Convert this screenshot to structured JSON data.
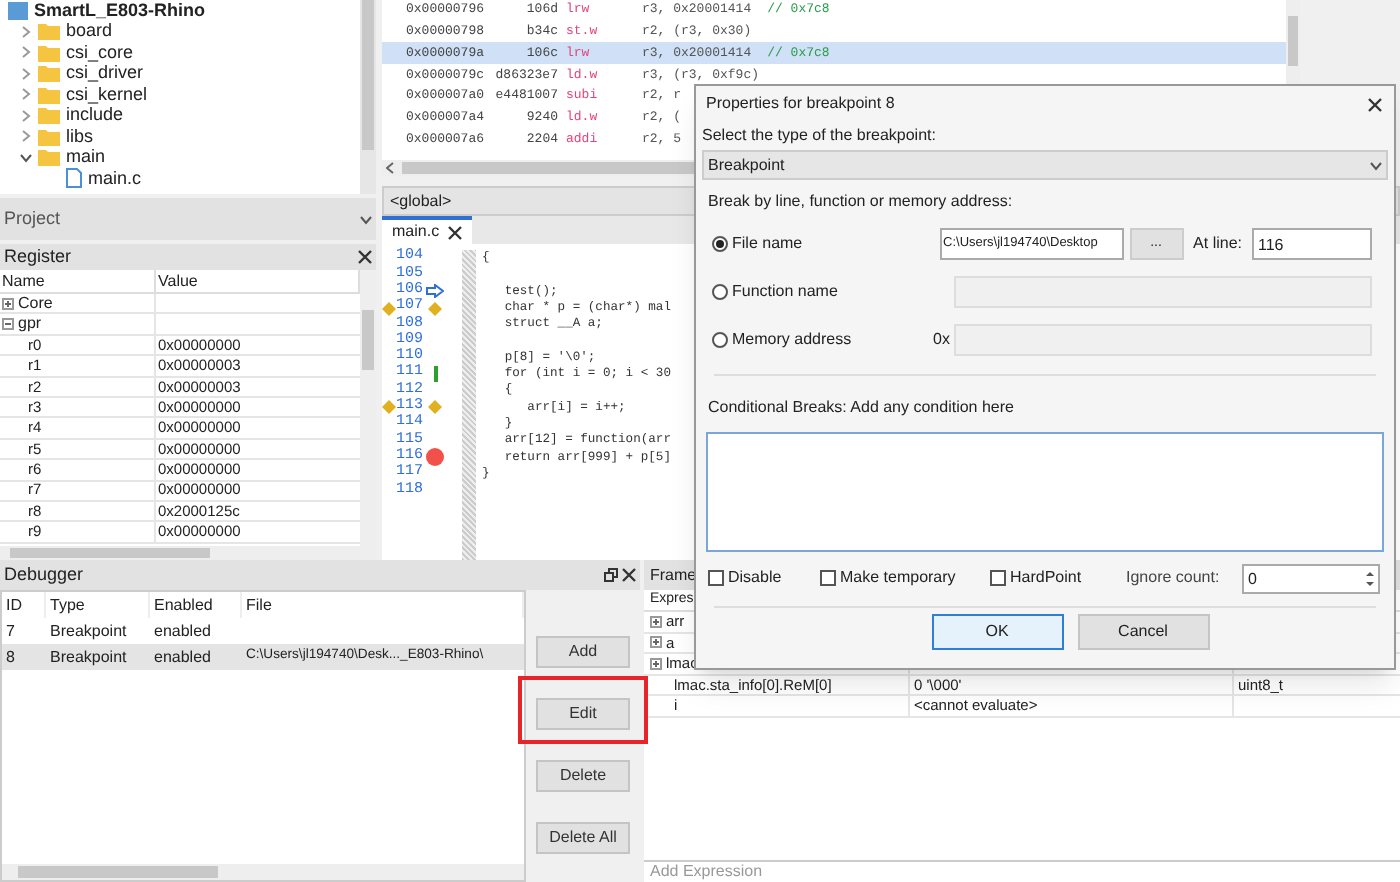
{
  "project_tree": {
    "root": "SmartL_E803-Rhino",
    "children": [
      {
        "name": "board",
        "kind": "folder",
        "expanded": false
      },
      {
        "name": "csi_core",
        "kind": "folder",
        "expanded": false
      },
      {
        "name": "csi_driver",
        "kind": "folder",
        "expanded": false
      },
      {
        "name": "csi_kernel",
        "kind": "folder",
        "expanded": false
      },
      {
        "name": "include",
        "kind": "folder",
        "expanded": false
      },
      {
        "name": "libs",
        "kind": "folder",
        "expanded": false
      },
      {
        "name": "main",
        "kind": "folder",
        "expanded": true,
        "children": [
          {
            "name": "main.c",
            "kind": "file"
          }
        ]
      }
    ]
  },
  "project_bar": {
    "title": "Project"
  },
  "register": {
    "title": "Register",
    "columns": [
      "Name",
      "Value"
    ],
    "groups": [
      {
        "name": "Core",
        "expanded": false
      },
      {
        "name": "gpr",
        "expanded": true,
        "children": [
          {
            "name": "r0",
            "value": "0x00000000"
          },
          {
            "name": "r1",
            "value": "0x00000003"
          },
          {
            "name": "r2",
            "value": "0x00000003"
          },
          {
            "name": "r3",
            "value": "0x00000000"
          },
          {
            "name": "r4",
            "value": "0x00000000"
          },
          {
            "name": "r5",
            "value": "0x00000000"
          },
          {
            "name": "r6",
            "value": "0x00000000"
          },
          {
            "name": "r7",
            "value": "0x00000000"
          },
          {
            "name": "r8",
            "value": "0x2000125c"
          },
          {
            "name": "r9",
            "value": "0x00000000"
          }
        ]
      }
    ]
  },
  "disassembly": [
    {
      "address": "0x00000796",
      "opcode": "106d",
      "mnemonic": "lrw",
      "operands": "r3, 0x20001414",
      "comment": "// 0x7c8",
      "selected": false
    },
    {
      "address": "0x00000798",
      "opcode": "b34c",
      "mnemonic": "st.w",
      "operands": "r2, (r3, 0x30)",
      "selected": false
    },
    {
      "address": "0x0000079a",
      "opcode": "106c",
      "mnemonic": "lrw",
      "operands": "r3, 0x20001414",
      "comment": "// 0x7c8",
      "selected": true
    },
    {
      "address": "0x0000079c",
      "opcode": "d86323e7",
      "mnemonic": "ld.w",
      "operands": "r3, (r3, 0xf9c)",
      "selected": false
    },
    {
      "address": "0x000007a0",
      "opcode": "e4481007",
      "mnemonic": "subi",
      "operands": "r2, r",
      "selected": false
    },
    {
      "address": "0x000007a4",
      "opcode": "9240",
      "mnemonic": "ld.w",
      "operands": "r2, (",
      "selected": false
    },
    {
      "address": "0x000007a6",
      "opcode": "2204",
      "mnemonic": "addi",
      "operands": "r2, 5",
      "selected": false
    }
  ],
  "editor": {
    "scope": "<global>",
    "tabs": [
      {
        "label": "main.c",
        "selected": true
      }
    ],
    "lines": [
      {
        "number": "104",
        "code": "{",
        "kind": "plain"
      },
      {
        "number": "105",
        "kind": "plain"
      },
      {
        "number": "106",
        "code": "   test();",
        "kind": "current"
      },
      {
        "number": "107",
        "code": "   char * p = (char*) mal",
        "kind": "bookmark"
      },
      {
        "number": "108",
        "code": "   struct __A a;",
        "kind": "plain"
      },
      {
        "number": "109",
        "kind": "plain"
      },
      {
        "number": "110",
        "code": "   p[8] = '\\0';",
        "kind": "plain"
      },
      {
        "number": "111",
        "code": "   for (int i = 0; i < 30",
        "kind": "changed"
      },
      {
        "number": "112",
        "code": "   {",
        "kind": "plain"
      },
      {
        "number": "113",
        "code": "      arr[i] = i++;",
        "kind": "bookmark"
      },
      {
        "number": "114",
        "code": "   }",
        "kind": "plain"
      },
      {
        "number": "115",
        "code": "   arr[12] = function(arr",
        "kind": "plain"
      },
      {
        "number": "116",
        "code": "   return arr[999] + p[5]",
        "kind": "breakpoint"
      },
      {
        "number": "117",
        "code": "}",
        "kind": "plain"
      },
      {
        "number": "118",
        "kind": "plain"
      }
    ]
  },
  "debugger": {
    "title": "Debugger",
    "columns": [
      "ID",
      "Type",
      "Enabled",
      "File"
    ],
    "rows": [
      {
        "id": "7",
        "type": "Breakpoint",
        "enabled": "enabled",
        "selected": false
      },
      {
        "id": "8",
        "type": "Breakpoint",
        "enabled": "enabled",
        "file": "C:\\Users\\jl194740\\Desk..._E803-Rhino\\",
        "selected": true
      }
    ],
    "buttons": [
      {
        "label": "Add",
        "highlighted": false
      },
      {
        "label": "Edit",
        "highlighted": true
      },
      {
        "label": "Delete",
        "highlighted": false
      },
      {
        "label": "Delete All",
        "highlighted": false
      }
    ]
  },
  "watch": {
    "tab": "Frame",
    "header": "Expres",
    "rows": [
      {
        "name": "arr",
        "expandable": true
      },
      {
        "name": "a",
        "expandable": true
      },
      {
        "name": "lmac",
        "expandable": true
      },
      {
        "name": "lmac.sta_info[0].ReM[0]",
        "value": "0 '\\000'",
        "type": "uint8_t",
        "expandable": false
      },
      {
        "name": "i",
        "value": "<cannot evaluate>",
        "expandable": false
      }
    ],
    "add_placeholder": "Add Expression"
  },
  "dialog": {
    "title": "Properties for breakpoint 8",
    "type_label": "Select the type of the breakpoint:",
    "type_value": "Breakpoint",
    "break_label": "Break by line, function or memory address:",
    "options": [
      {
        "label": "File name",
        "kind": "file",
        "selected": true
      },
      {
        "label": "Function name",
        "kind": "function",
        "selected": false
      },
      {
        "label": "Memory address",
        "kind": "memory",
        "selected": false
      }
    ],
    "file_value": "C:\\Users\\jl194740\\Desktop",
    "browse": "...",
    "at_line_label": "At line:",
    "at_line_value": "116",
    "memory_prefix": "0x",
    "condition_label": "Conditional Breaks: Add any condition here",
    "checks": [
      {
        "label": "Disable",
        "checked": false
      },
      {
        "label": "Make temporary",
        "checked": false
      },
      {
        "label": "HardPoint",
        "checked": false
      }
    ],
    "ignore_label": "Ignore count:",
    "ignore_value": "0",
    "buttons": [
      {
        "label": "OK",
        "default": true
      },
      {
        "label": "Cancel",
        "default": false
      }
    ]
  }
}
